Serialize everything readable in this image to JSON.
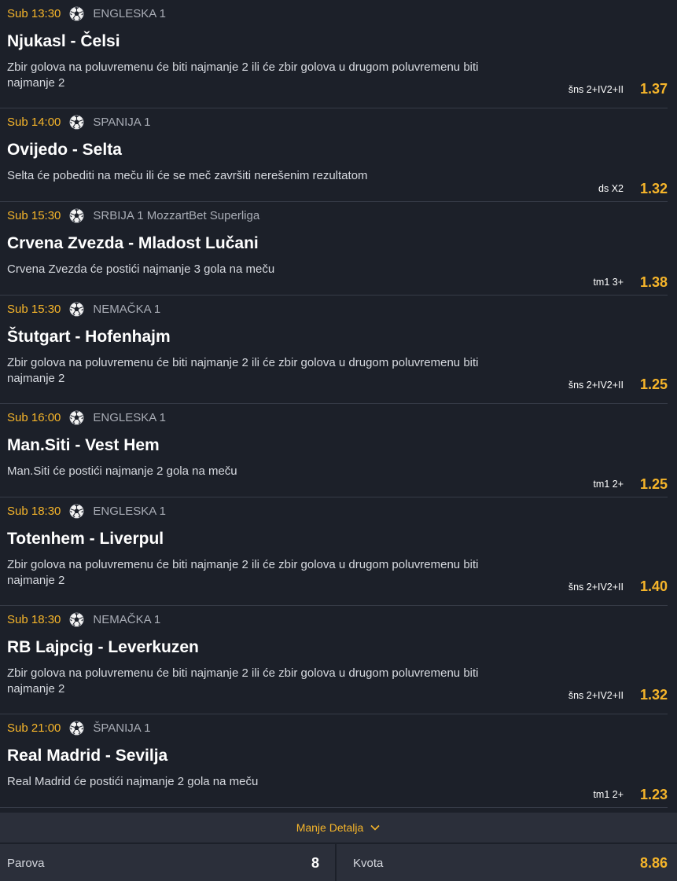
{
  "matches": [
    {
      "time": "Sub 13:30",
      "league": "ENGLESKA 1",
      "teams": "Njukasl - Čelsi",
      "desc": "Zbir golova na poluvremenu će biti najmanje 2 ili će zbir golova u drugom poluvremenu biti najmanje 2",
      "code": "šns 2+IV2+II",
      "odd": "1.37"
    },
    {
      "time": "Sub 14:00",
      "league": "SPANIJA 1",
      "teams": "Ovijedo - Selta",
      "desc": "Selta će pobediti na meču ili će se meč završiti nerešenim rezultatom",
      "code": "ds X2",
      "odd": "1.32"
    },
    {
      "time": "Sub 15:30",
      "league": "SRBIJA 1 MozzartBet Superliga",
      "teams": "Crvena Zvezda - Mladost Lučani",
      "desc": "Crvena Zvezda će postići najmanje 3 gola na meču",
      "code": "tm1 3+",
      "odd": "1.38"
    },
    {
      "time": "Sub 15:30",
      "league": "NEMAČKA 1",
      "teams": "Štutgart - Hofenhajm",
      "desc": "Zbir golova na poluvremenu će biti najmanje 2 ili će zbir golova u drugom poluvremenu biti najmanje 2",
      "code": "šns 2+IV2+II",
      "odd": "1.25"
    },
    {
      "time": "Sub 16:00",
      "league": "ENGLESKA 1",
      "teams": "Man.Siti - Vest Hem",
      "desc": "Man.Siti će postići najmanje 2 gola na meču",
      "code": "tm1 2+",
      "odd": "1.25"
    },
    {
      "time": "Sub 18:30",
      "league": "ENGLESKA 1",
      "teams": "Totenhem - Liverpul",
      "desc": "Zbir golova na poluvremenu će biti najmanje 2 ili će zbir golova u drugom poluvremenu biti najmanje 2",
      "code": "šns 2+IV2+II",
      "odd": "1.40"
    },
    {
      "time": "Sub 18:30",
      "league": "NEMAČKA 1",
      "teams": "RB Lajpcig - Leverkuzen",
      "desc": "Zbir golova na poluvremenu će biti najmanje 2 ili će zbir golova u drugom poluvremenu biti najmanje 2",
      "code": "šns 2+IV2+II",
      "odd": "1.32"
    },
    {
      "time": "Sub 21:00",
      "league": "ŠPANIJA 1",
      "teams": "Real Madrid - Sevilja",
      "desc": "Real Madrid će postići najmanje 2 gola na meču",
      "code": "tm1 2+",
      "odd": "1.23"
    }
  ],
  "footer": {
    "toggle_label": "Manje Detalja",
    "pairs_label": "Parova",
    "pairs_value": "8",
    "odds_label": "Kvota",
    "odds_value": "8.86"
  },
  "icons": {
    "sport": "soccer-ball-icon",
    "toggle": "chevron-down-icon"
  },
  "colors": {
    "accent": "#f6b52a",
    "background": "#1c2029",
    "footer": "#2b2f3a"
  }
}
